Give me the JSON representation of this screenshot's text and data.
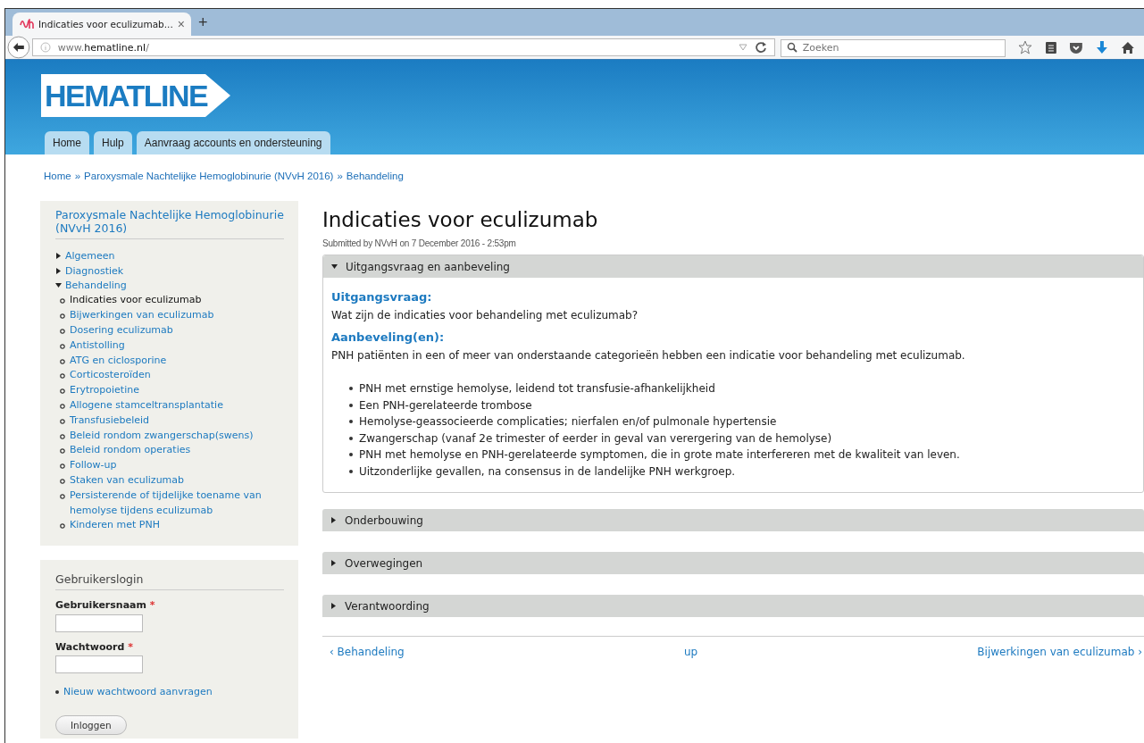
{
  "browser": {
    "tab_title": "Indicaties voor eculizumab...",
    "tab_close": "×",
    "new_tab": "+",
    "url_prefix": "www.",
    "url_domain": "hematline.nl",
    "url_suffix": "/",
    "search_placeholder": "Zoeken"
  },
  "site": {
    "logo": "HEMATLINE",
    "nav": [
      "Home",
      "Hulp",
      "Aanvraag accounts en ondersteuning"
    ]
  },
  "breadcrumb": [
    "Home",
    "Paroxysmale Nachtelijke Hemoglobinurie (NVvH 2016)",
    "Behandeling"
  ],
  "breadcrumb_separator": "»",
  "sidebar": {
    "title": "Paroxysmale Nachtelijke Hemoglobinurie (NVvH 2016)",
    "items": [
      {
        "label": "Algemeen",
        "expanded": false
      },
      {
        "label": "Diagnostiek",
        "expanded": false
      },
      {
        "label": "Behandeling",
        "expanded": true,
        "children": [
          {
            "label": "Indicaties voor eculizumab",
            "selected": true
          },
          {
            "label": "Bijwerkingen van eculizumab",
            "selected": false
          },
          {
            "label": "Dosering eculizumab",
            "selected": false
          },
          {
            "label": "Antistolling",
            "selected": false
          },
          {
            "label": "ATG en ciclosporine",
            "selected": false
          },
          {
            "label": "Corticosteroïden",
            "selected": false
          },
          {
            "label": "Erytropoietine",
            "selected": false
          },
          {
            "label": "Allogene stamceltransplantatie",
            "selected": false
          },
          {
            "label": "Transfusiebeleid",
            "selected": false
          },
          {
            "label": "Beleid rondom zwangerschap(swens)",
            "selected": false
          },
          {
            "label": "Beleid rondom operaties",
            "selected": false
          },
          {
            "label": "Follow-up",
            "selected": false
          },
          {
            "label": "Staken van eculizumab",
            "selected": false
          },
          {
            "label": "Persisterende of tijdelijke toename van hemolyse tijdens eculizumab",
            "selected": false
          },
          {
            "label": "Kinderen met PNH",
            "selected": false
          }
        ]
      }
    ]
  },
  "login": {
    "title": "Gebruikerslogin",
    "fields": [
      {
        "label": "Gebruikersnaam",
        "required_mark": "*"
      },
      {
        "label": "Wachtwoord",
        "required_mark": "*"
      }
    ],
    "link": "Nieuw wachtwoord aanvragen",
    "button": "Inloggen"
  },
  "article": {
    "title": "Indicaties voor eculizumab",
    "submitted": "Submitted by NVvH on 7 December 2016 - 2:53pm",
    "sections": [
      {
        "title": "Uitgangsvraag en aanbeveling",
        "expanded": true,
        "body": [
          {
            "kind": "heading",
            "text": "Uitgangsvraag:"
          },
          {
            "kind": "paragraph",
            "text": "Wat zijn de indicaties voor behandeling met eculizumab?"
          },
          {
            "kind": "heading",
            "text": "Aanbeveling(en):"
          },
          {
            "kind": "paragraph",
            "text": "PNH patiënten in een of meer van onderstaande categorieën hebben een indicatie voor behandeling met eculizumab."
          },
          {
            "kind": "list",
            "items": [
              "PNH met ernstige hemolyse, leidend tot transfusie-afhankelijkheid",
              "Een PNH-gerelateerde trombose",
              "Hemolyse-geassocieerde complicaties; nierfalen en/of pulmonale hypertensie",
              "Zwangerschap (vanaf 2e trimester of eerder in geval van verergering van de hemolyse)",
              "PNH met hemolyse en PNH-gerelateerde symptomen, die in grote mate interfereren met de kwaliteit van leven.",
              "Uitzonderlijke gevallen, na consensus in de landelijke PNH werkgroep."
            ]
          }
        ]
      },
      {
        "title": "Onderbouwing",
        "expanded": false
      },
      {
        "title": "Overwegingen",
        "expanded": false
      },
      {
        "title": "Verantwoording",
        "expanded": false
      }
    ],
    "pager": {
      "prev": "‹ Behandeling",
      "up": "up",
      "next": "Bijwerkingen van eculizumab ›"
    }
  }
}
